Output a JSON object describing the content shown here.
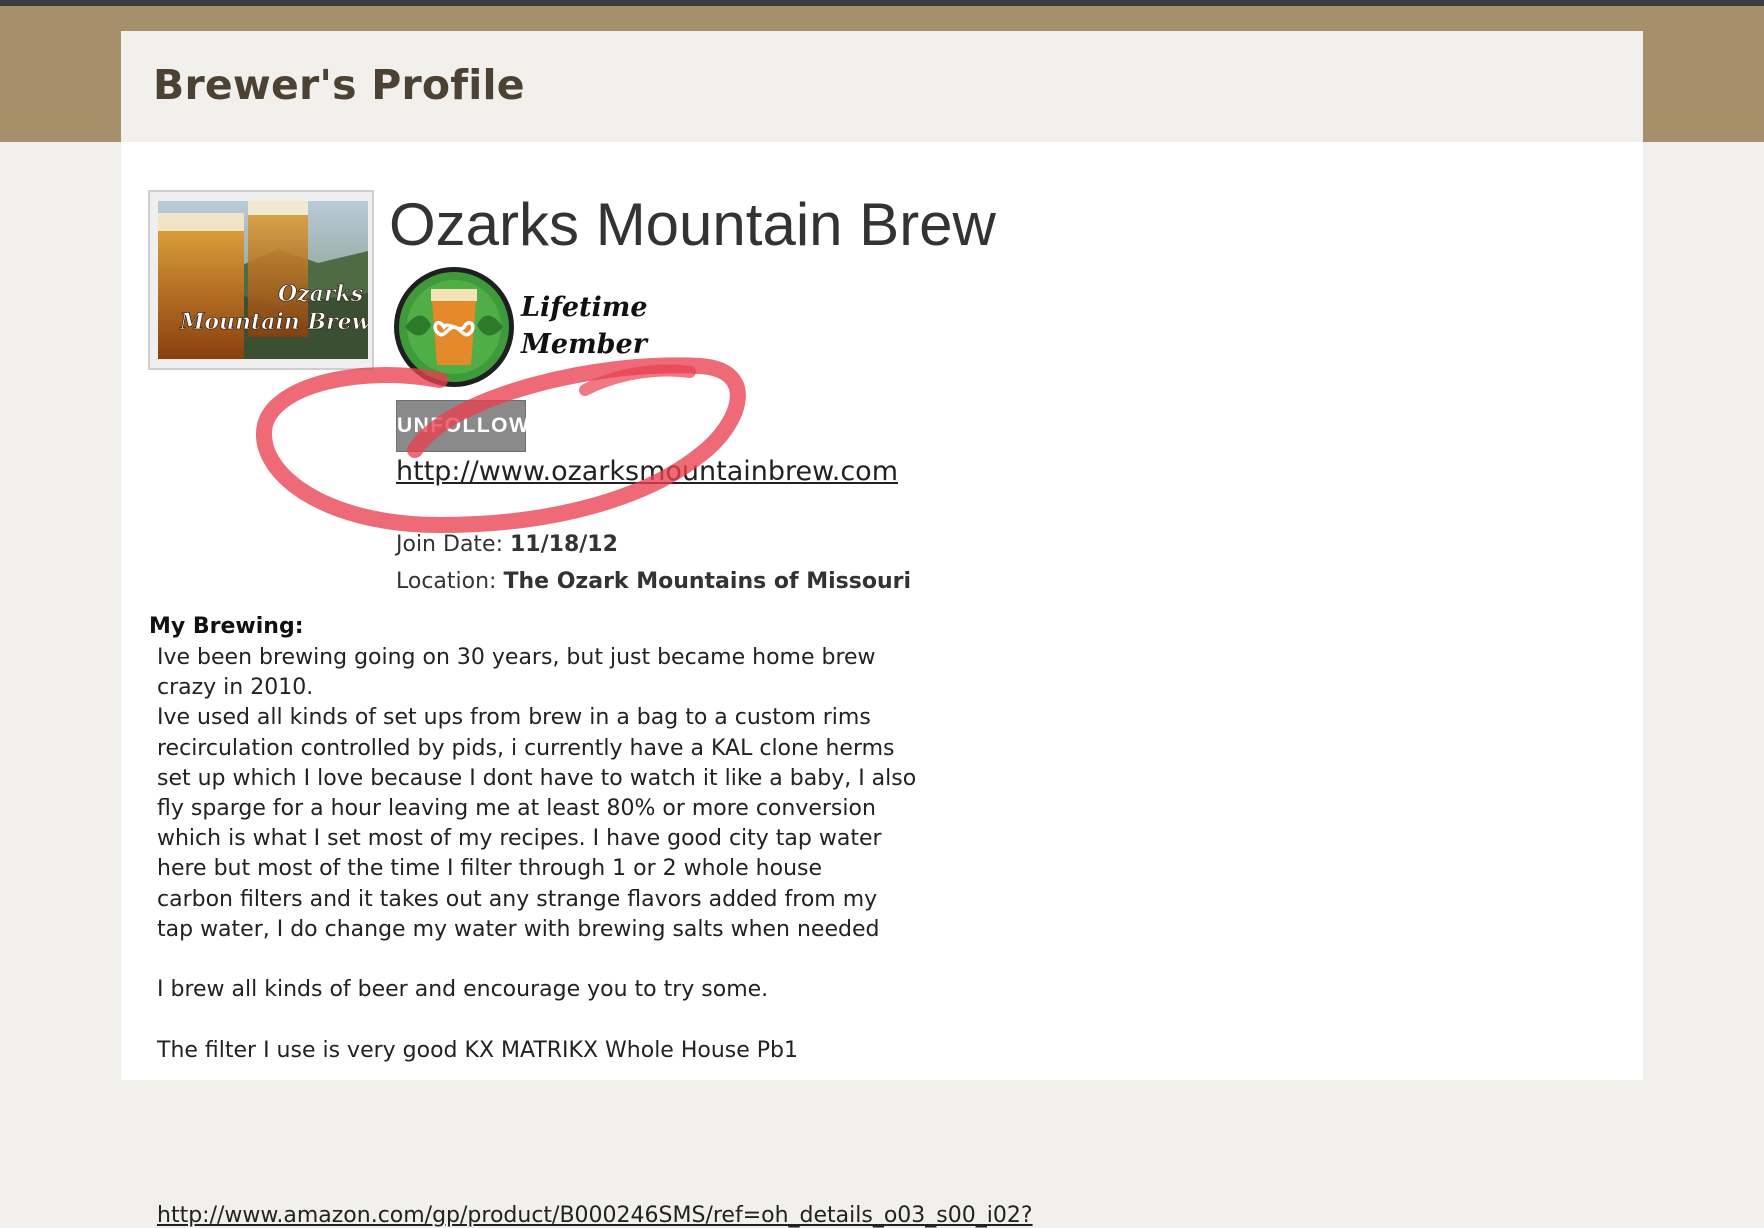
{
  "header": {
    "title": "Brewer's Profile"
  },
  "profile": {
    "name": "Ozarks Mountain Brew",
    "avatar_text": [
      "Ozarks",
      "Mountain Brew"
    ],
    "badge": {
      "line1": "Lifetime",
      "line2": "Member",
      "icon": "beer-glass-infinity-icon"
    },
    "unfollow_label": "UNFOLLOW",
    "website": "http://www.ozarksmountainbrew.com",
    "join_label": "Join Date:",
    "join_date": "11/18/12",
    "location_label": "Location:",
    "location": "The Ozark Mountains of Missouri"
  },
  "brewing": {
    "heading": "My Brewing:",
    "text": "Ive been brewing going on 30 years, but just became home brew\ncrazy in 2010.\nIve used all kinds of set ups from brew in a bag to a custom rims\nrecirculation controlled by pids, i currently have a KAL clone herms\nset up which I love because I dont have to watch it like a baby, I also\nfly sparge for a hour leaving me at least 80% or more conversion\nwhich is what I set most of my recipes. I have good city tap water\nhere but most of the time I filter through 1 or 2 whole house\ncarbon filters and it takes out any strange flavors added from my\ntap water, I do change my water with brewing salts when needed\n\nI brew all kinds of beer and encourage you to try some.\n\nThe filter I use is very good KX MATRIKX Whole House Pb1",
    "link_partial": "http://www.amazon.com/gp/product/B000246SMS/ref=oh_details_o03_s00_i02?"
  },
  "colors": {
    "header_band": "#a6906c",
    "top_bar": "#3c3b3d",
    "annotation_stroke": "#e8404f",
    "badge_green": "#3f9a3c"
  }
}
